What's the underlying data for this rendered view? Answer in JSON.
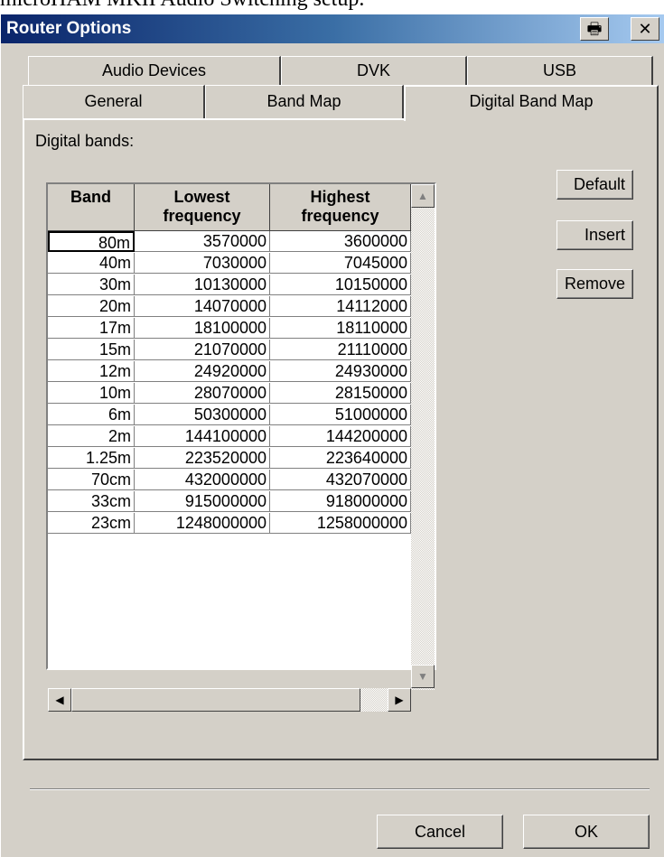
{
  "caption": "microHAM MKII Audio Switching setup.",
  "window": {
    "title": "Router Options",
    "print_icon": "printer-icon",
    "close_icon": "close-icon",
    "close_glyph": "✕"
  },
  "tabs_row1": [
    "Audio Devices",
    "DVK",
    "USB"
  ],
  "tabs_row2": [
    "General",
    "Band Map",
    "Digital Band Map"
  ],
  "active_tab": "Digital Band Map",
  "panel": {
    "label": "Digital bands:",
    "columns": [
      "Band",
      "Lowest frequency",
      "Highest frequency"
    ],
    "rows": [
      [
        "80m",
        "3570000",
        "3600000"
      ],
      [
        "40m",
        "7030000",
        "7045000"
      ],
      [
        "30m",
        "10130000",
        "10150000"
      ],
      [
        "20m",
        "14070000",
        "14112000"
      ],
      [
        "17m",
        "18100000",
        "18110000"
      ],
      [
        "15m",
        "21070000",
        "21110000"
      ],
      [
        "12m",
        "24920000",
        "24930000"
      ],
      [
        "10m",
        "28070000",
        "28150000"
      ],
      [
        "6m",
        "50300000",
        "51000000"
      ],
      [
        "2m",
        "144100000",
        "144200000"
      ],
      [
        "1.25m",
        "223520000",
        "223640000"
      ],
      [
        "70cm",
        "432000000",
        "432070000"
      ],
      [
        "33cm",
        "915000000",
        "918000000"
      ],
      [
        "23cm",
        "1248000000",
        "1258000000"
      ]
    ],
    "buttons": {
      "default": "Default",
      "insert": "Insert",
      "remove": "Remove"
    }
  },
  "footer": {
    "cancel": "Cancel",
    "ok": "OK"
  },
  "colors": {
    "titlebar_start": "#0a246a",
    "titlebar_end": "#a6caf0",
    "face": "#d4d0c8"
  }
}
